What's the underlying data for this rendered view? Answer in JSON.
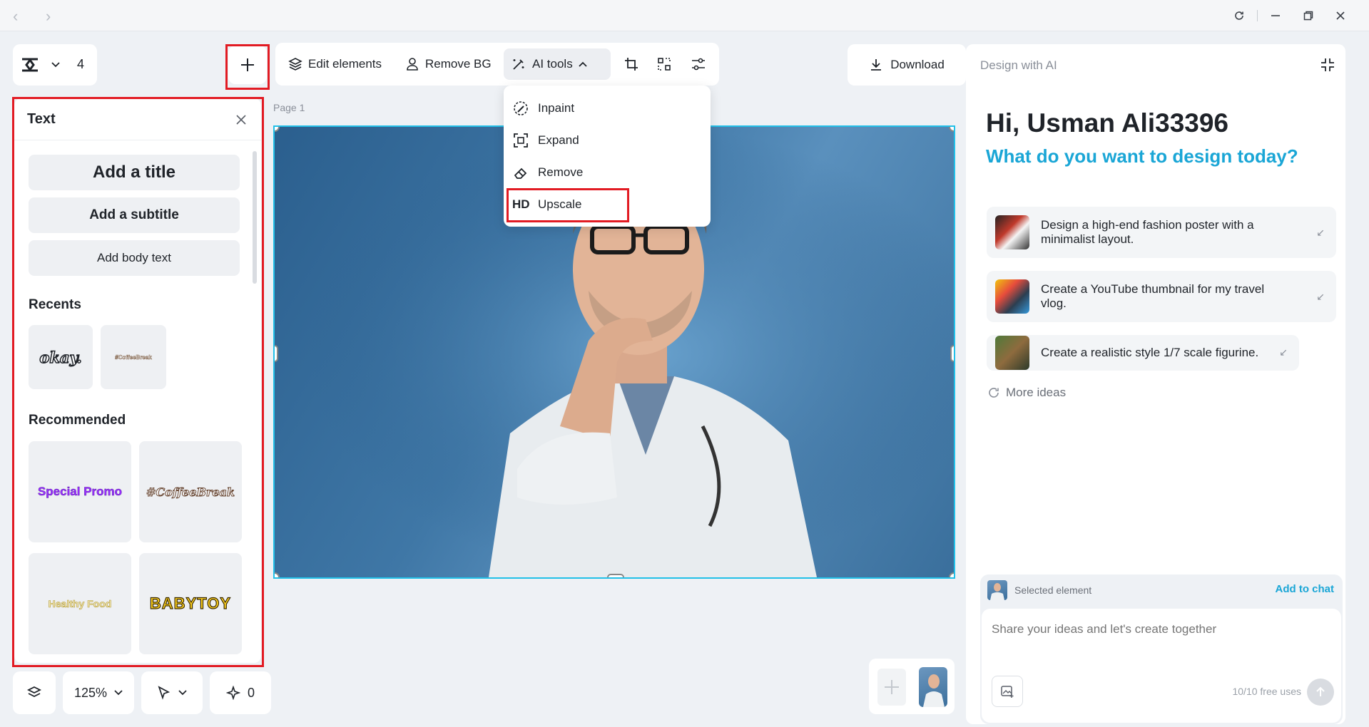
{
  "toolbar": {
    "page_count": "4",
    "edit_elements": "Edit elements",
    "remove_bg": "Remove BG",
    "ai_tools": "AI tools",
    "download": "Download"
  },
  "ai_menu": {
    "items": [
      "Inpaint",
      "Expand",
      "Remove",
      "Upscale"
    ],
    "hd_badge": "HD"
  },
  "text_panel": {
    "title": "Text",
    "add_title": "Add a title",
    "add_subtitle": "Add a subtitle",
    "add_body": "Add body text",
    "recents_label": "Recents",
    "recents": [
      "okay.",
      "#CoffeeBreak"
    ],
    "recommended_label": "Recommended",
    "recommended": [
      "Special Promo",
      "#CoffeeBreak",
      "Healthy Food",
      "BABYTOY"
    ]
  },
  "canvas": {
    "page_label": "Page 1"
  },
  "bottom_bar": {
    "zoom": "125%",
    "credits": "0"
  },
  "ai_panel": {
    "header": "Design with AI",
    "greeting": "Hi, Usman Ali33396",
    "subgreeting": "What do you want to design today?",
    "ideas": [
      {
        "line1": "Design a high-end fashion poster with a",
        "line2": "minimalist layout."
      },
      {
        "line1": "Create a YouTube thumbnail for my travel",
        "line2": "vlog."
      },
      {
        "line1": "Create a realistic style 1/7 scale figurine.",
        "line2": ""
      }
    ],
    "more_ideas": "More ideas",
    "selected_element": "Selected element",
    "add_to_chat": "Add to chat",
    "input_placeholder": "Share your ideas and let's create together",
    "free_uses": "10/10 free uses"
  },
  "colors": {
    "accent": "#1aa6d6",
    "highlight": "#e21b23",
    "canvas_bg": "#3f77a6"
  }
}
